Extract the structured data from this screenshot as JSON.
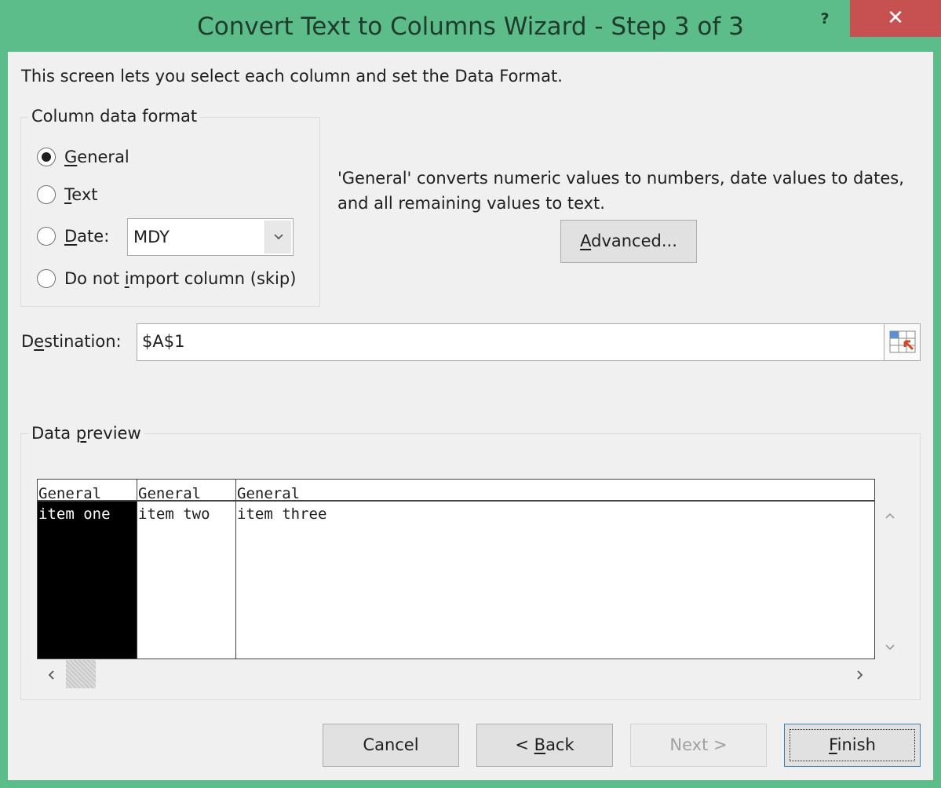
{
  "window": {
    "title": "Convert Text to Columns Wizard - Step 3 of 3",
    "help_label": "?",
    "close_label": "✕",
    "colors": {
      "frame": "#5dbd8a",
      "close": "#c75050",
      "client": "#f0f0f0"
    }
  },
  "intro": "This screen lets you select each column and set the Data Format.",
  "column_format": {
    "legend": "Column data format",
    "options": [
      {
        "pre": "",
        "key": "G",
        "post": "eneral",
        "checked": true
      },
      {
        "pre": "",
        "key": "T",
        "post": "ext",
        "checked": false
      },
      {
        "pre": "",
        "key": "D",
        "post": "ate:",
        "checked": false
      },
      {
        "pre": "Do not ",
        "key": "i",
        "post": "mport column (skip)",
        "checked": false
      }
    ],
    "date_value": "MDY"
  },
  "description": {
    "line1": "'General' converts numeric values to numbers, date values to dates,",
    "line2": "and all remaining values to text."
  },
  "advanced_button": {
    "key": "A",
    "post": "dvanced..."
  },
  "destination": {
    "pre": "D",
    "key": "e",
    "post": "stination:",
    "value": "$A$1"
  },
  "preview": {
    "legend_pre": "Data ",
    "legend_key": "p",
    "legend_post": "review",
    "columns": [
      {
        "header": "General",
        "value": "item one",
        "selected": true
      },
      {
        "header": "General",
        "value": "item two",
        "selected": false
      },
      {
        "header": "General",
        "value": "item three",
        "selected": false
      }
    ]
  },
  "buttons": {
    "cancel": "Cancel",
    "back_pre": "< ",
    "back_key": "B",
    "back_post": "ack",
    "next": "Next >",
    "finish_key": "F",
    "finish_post": "inish"
  }
}
